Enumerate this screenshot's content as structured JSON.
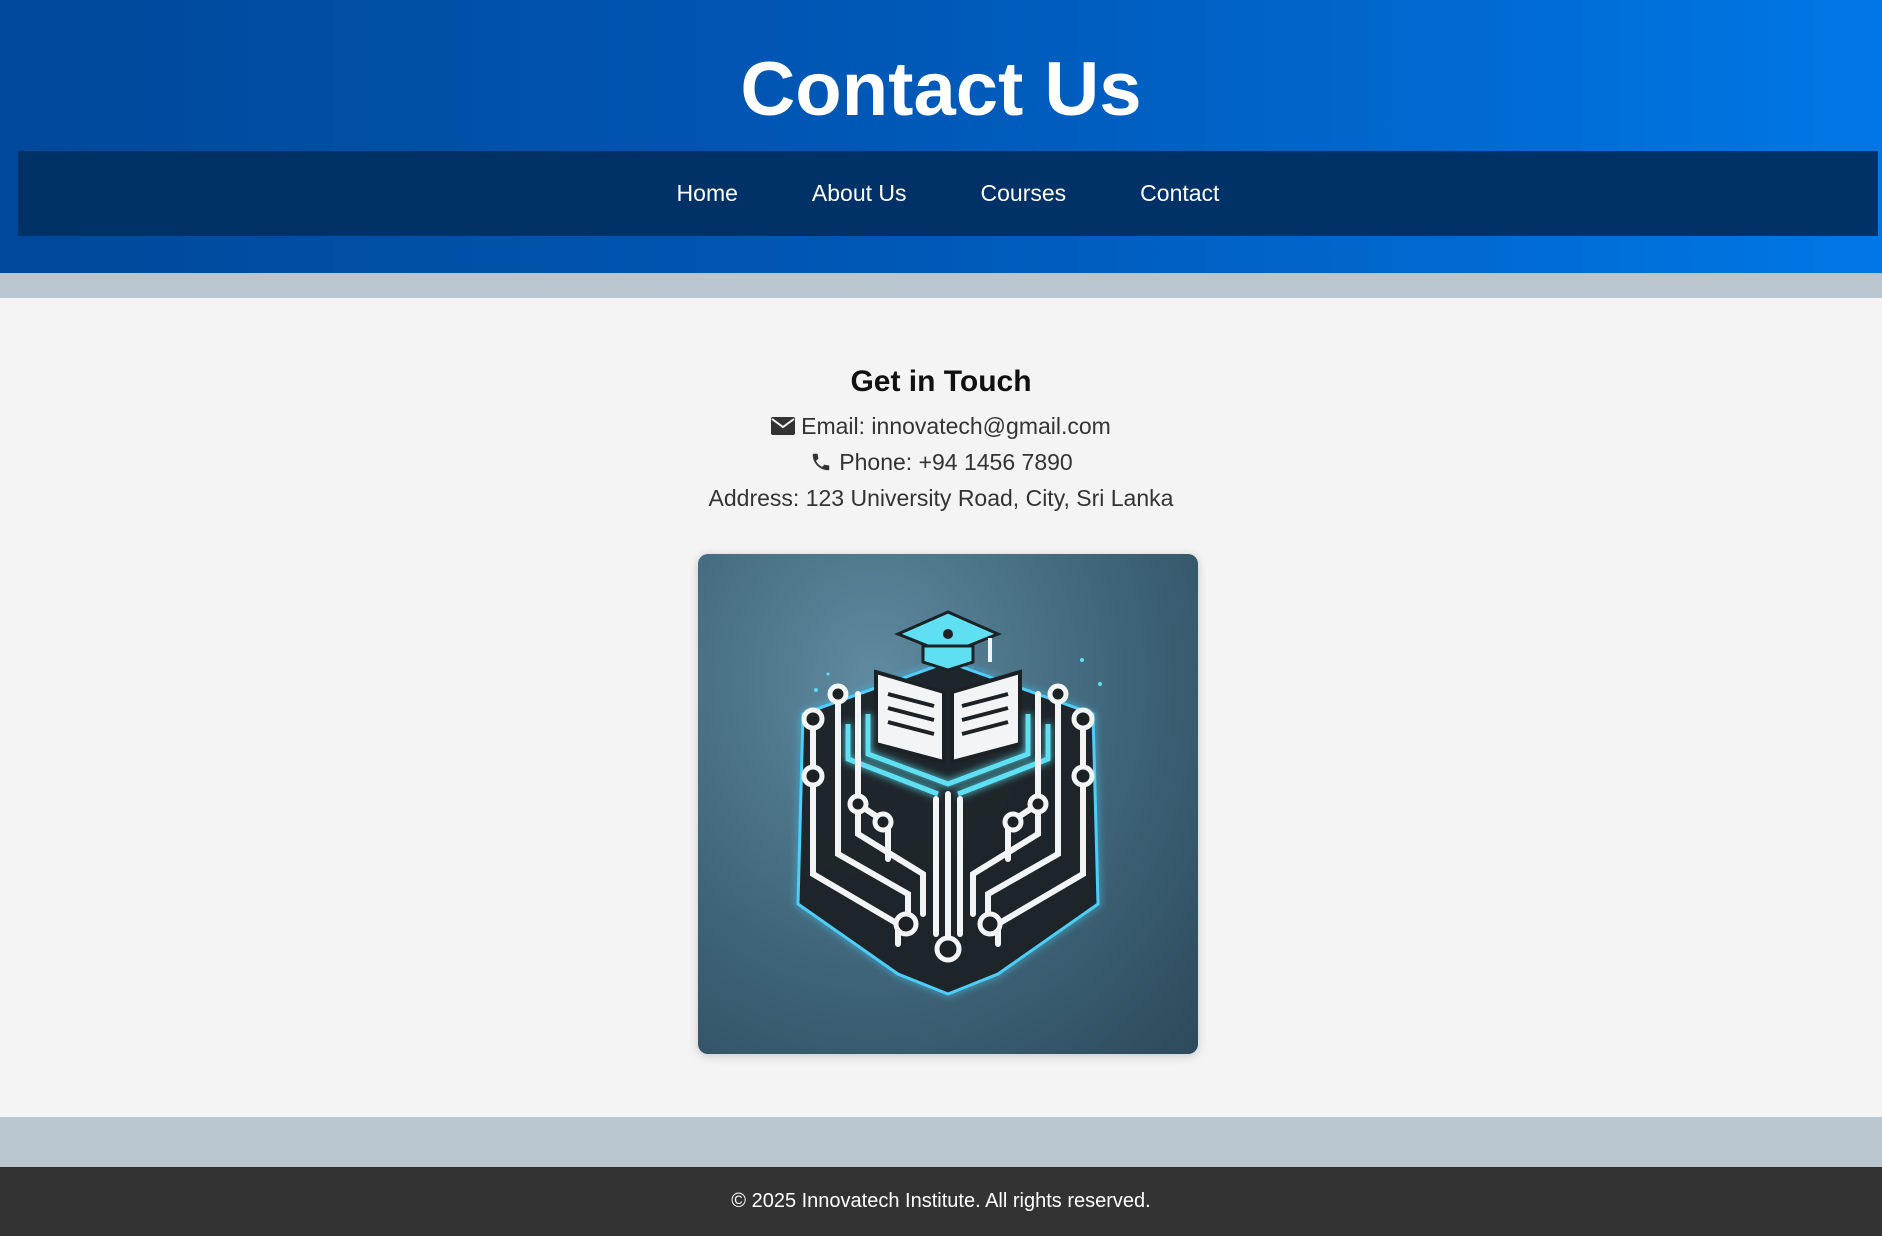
{
  "header": {
    "title": "Contact Us"
  },
  "nav": {
    "items": [
      {
        "label": "Home"
      },
      {
        "label": "About Us"
      },
      {
        "label": "Courses"
      },
      {
        "label": "Contact"
      }
    ]
  },
  "contact": {
    "heading": "Get in Touch",
    "email_text": "Email: innovatech@gmail.com",
    "phone_text": "Phone: +94 1456 7890",
    "address_text": "Address: 123 University Road, City, Sri Lanka",
    "email_icon": "envelope-icon",
    "phone_icon": "phone-icon"
  },
  "logo": {
    "icon": "graduation-book-circuit-logo",
    "colors": {
      "accent": "#5fe0f2",
      "line": "#f2f4f5",
      "base": "#1c2126"
    }
  },
  "footer": {
    "text": "© 2025 Innovatech Institute. All rights reserved."
  },
  "colors": {
    "header_start": "#00489a",
    "header_end": "#0077e6",
    "nav_bg": "#003167",
    "page_bg": "#f4f4f4",
    "band_bg": "#b9c5cf",
    "footer_bg": "#333333"
  }
}
